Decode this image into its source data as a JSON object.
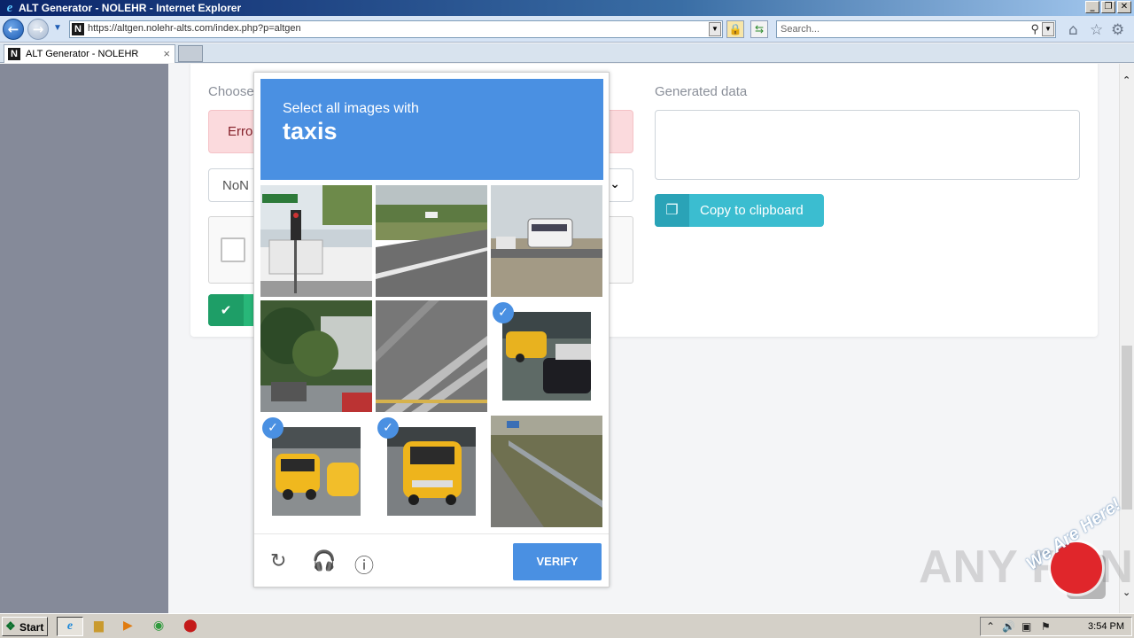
{
  "window": {
    "title": "ALT Generator - NOLEHR - Internet Explorer"
  },
  "browser": {
    "url": "https://altgen.nolehr-alts.com/index.php?p=altgen",
    "search_placeholder": "Search...",
    "tab_label": "ALT Generator - NOLEHR",
    "site_logo_letter": "N"
  },
  "page": {
    "choose_label": "Choose",
    "error_text": "Erro",
    "select_value": "NoN",
    "generated_label": "Generated data",
    "copy_button_label": "Copy to clipboard"
  },
  "captcha": {
    "instruction": "Select all images with",
    "target": "taxis",
    "verify_label": "VERIFY",
    "tiles": [
      {
        "selected": false,
        "scene": "traffic-light-street"
      },
      {
        "selected": false,
        "scene": "highway-road"
      },
      {
        "selected": false,
        "scene": "bus-on-road"
      },
      {
        "selected": false,
        "scene": "trees-building"
      },
      {
        "selected": false,
        "scene": "crosswalk"
      },
      {
        "selected": true,
        "scene": "taxi-street"
      },
      {
        "selected": true,
        "scene": "taxi-street"
      },
      {
        "selected": true,
        "scene": "taxi-rear"
      },
      {
        "selected": false,
        "scene": "highway-guardrail"
      }
    ]
  },
  "watermark": {
    "text": "ANY RUN",
    "tag": "We Are Here!"
  },
  "taskbar": {
    "start_label": "Start",
    "clock": "3:54 PM"
  }
}
